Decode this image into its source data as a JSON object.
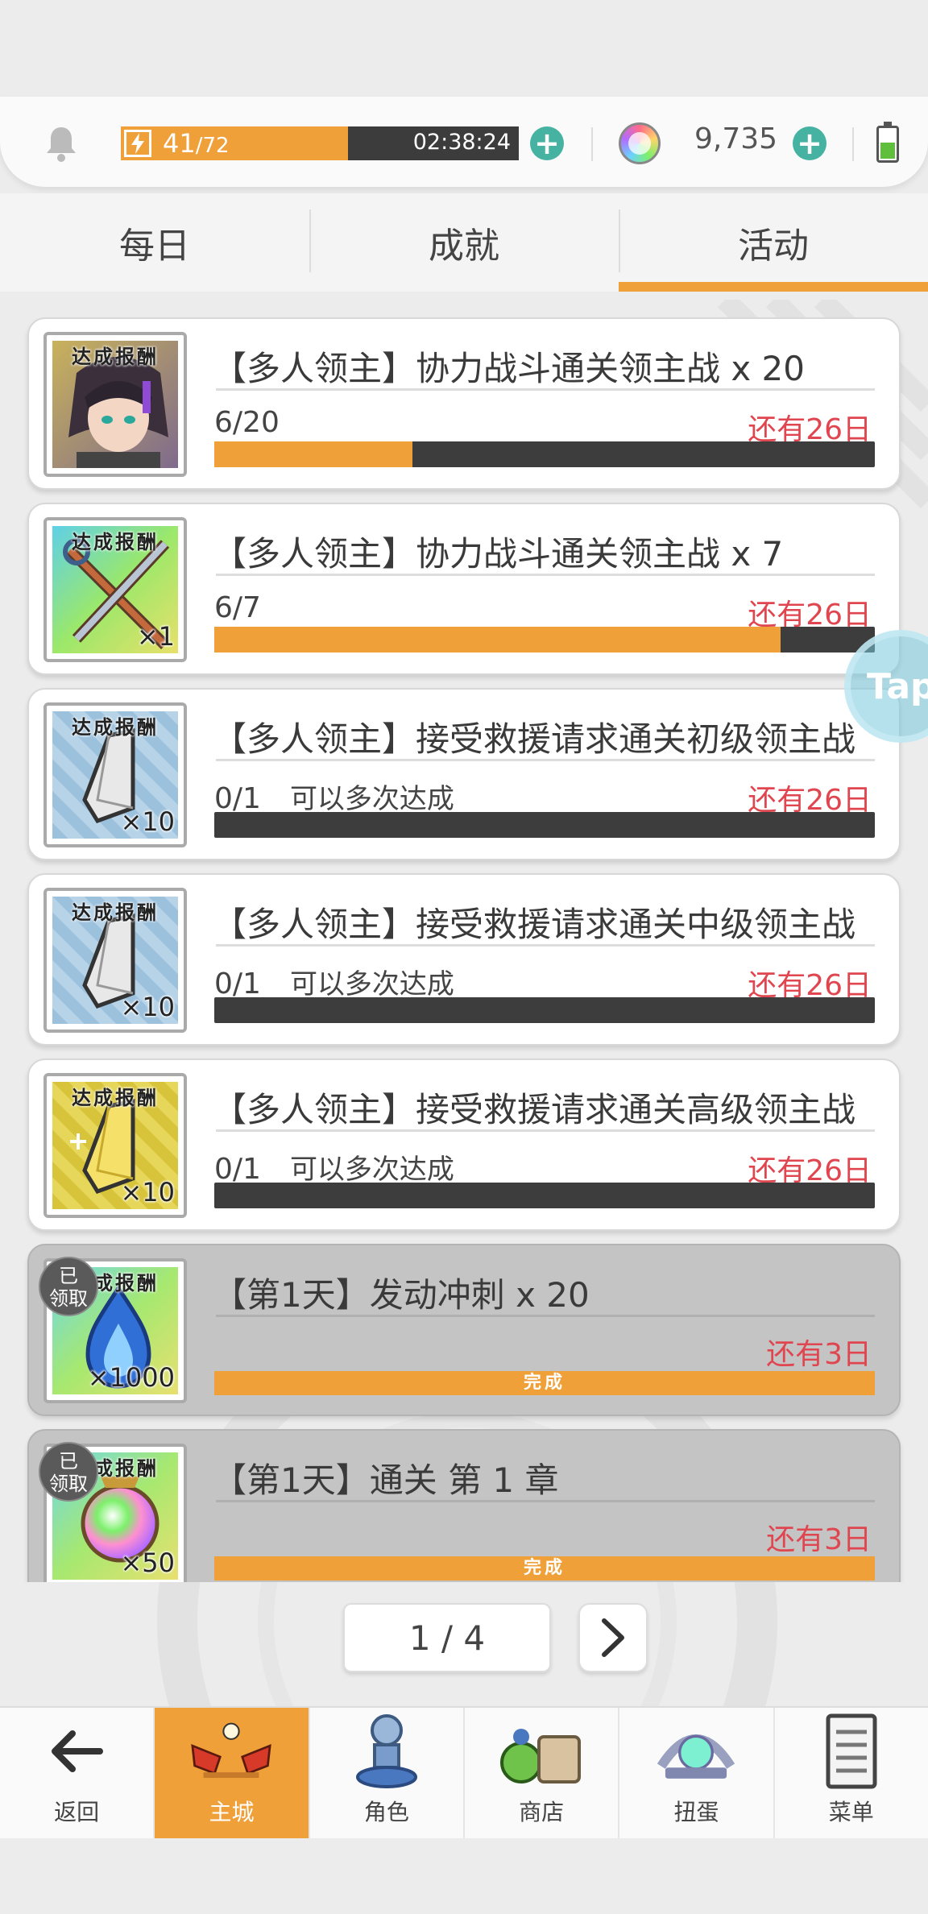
{
  "status_bar": {
    "stamina_current": "41",
    "stamina_max": "/72",
    "stamina_fraction": 0.57,
    "stamina_timer": "02:38:24",
    "gem_count": "9,735",
    "icons": [
      "bell-icon",
      "lightning-icon",
      "plus-icon",
      "rainbow-gem-icon",
      "battery-icon"
    ],
    "accent_color": "#f0a038",
    "plus_color": "#46b2a2"
  },
  "tabs": [
    {
      "label": "每日",
      "active": false
    },
    {
      "label": "成就",
      "active": false
    },
    {
      "label": "活动",
      "active": true
    }
  ],
  "reward_tag": "达成报酬",
  "claimed_label_1": "已",
  "claimed_label_2": "领取",
  "done_label": "完成",
  "tasks": [
    {
      "title": "【多人领主】协力战斗通关领主战 x 20",
      "progress": "6/20",
      "note": "",
      "remaining": "还有26日",
      "fraction": 0.3,
      "reward_count": "",
      "reward_icon": "character-portrait-icon",
      "done": false
    },
    {
      "title": "【多人领主】协力战斗通关领主战 x 7",
      "progress": "6/7",
      "note": "",
      "remaining": "还有26日",
      "fraction": 0.857,
      "reward_count": "×1",
      "reward_icon": "crossed-swords-icon",
      "done": false
    },
    {
      "title": "【多人领主】接受救援请求通关初级领主战",
      "progress": "0/1",
      "note": "可以多次达成",
      "remaining": "还有26日",
      "fraction": 0,
      "reward_count": "×10",
      "reward_icon": "white-crystal-icon",
      "done": false
    },
    {
      "title": "【多人领主】接受救援请求通关中级领主战",
      "progress": "0/1",
      "note": "可以多次达成",
      "remaining": "还有26日",
      "fraction": 0,
      "reward_count": "×10",
      "reward_icon": "white-crystal-icon",
      "done": false
    },
    {
      "title": "【多人领主】接受救援请求通关高级领主战",
      "progress": "0/1",
      "note": "可以多次达成",
      "remaining": "还有26日",
      "fraction": 0,
      "reward_count": "×10",
      "reward_icon": "gold-crystal-icon",
      "done": false
    },
    {
      "title": "【第1天】发动冲刺 x 20",
      "progress": "",
      "note": "",
      "remaining": "还有3日",
      "fraction": 1,
      "reward_count": "×1000",
      "reward_icon": "blue-flame-icon",
      "done": true
    },
    {
      "title": "【第1天】通关 第 1 章",
      "progress": "",
      "note": "",
      "remaining": "还有3日",
      "fraction": 1,
      "reward_count": "×50",
      "reward_icon": "rainbow-orb-icon",
      "done": true
    }
  ],
  "pager": {
    "text": "1 / 4"
  },
  "tap_hint": "Tap",
  "bottom_nav": [
    {
      "label": "返回",
      "icon": "back-arrow-icon",
      "active": false
    },
    {
      "label": "主城",
      "icon": "castle-icon",
      "active": true
    },
    {
      "label": "角色",
      "icon": "character-statue-icon",
      "active": false
    },
    {
      "label": "商店",
      "icon": "shop-bag-icon",
      "active": false
    },
    {
      "label": "扭蛋",
      "icon": "gacha-icon",
      "active": false
    },
    {
      "label": "菜单",
      "icon": "menu-list-icon",
      "active": false
    }
  ]
}
